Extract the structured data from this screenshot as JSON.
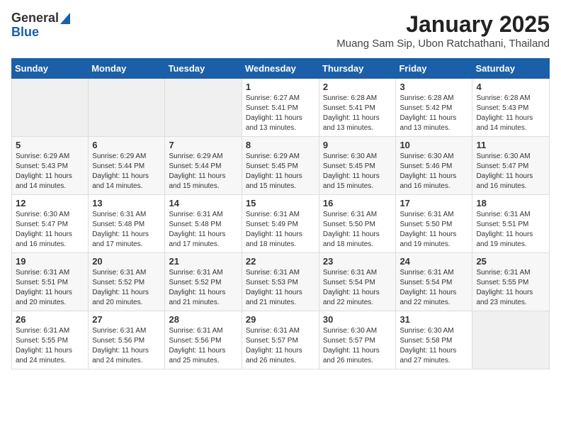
{
  "logo": {
    "general": "General",
    "blue": "Blue"
  },
  "header": {
    "month": "January 2025",
    "location": "Muang Sam Sip, Ubon Ratchathani, Thailand"
  },
  "weekdays": [
    "Sunday",
    "Monday",
    "Tuesday",
    "Wednesday",
    "Thursday",
    "Friday",
    "Saturday"
  ],
  "weeks": [
    [
      {
        "day": "",
        "sunrise": "",
        "sunset": "",
        "daylight": ""
      },
      {
        "day": "",
        "sunrise": "",
        "sunset": "",
        "daylight": ""
      },
      {
        "day": "",
        "sunrise": "",
        "sunset": "",
        "daylight": ""
      },
      {
        "day": "1",
        "sunrise": "Sunrise: 6:27 AM",
        "sunset": "Sunset: 5:41 PM",
        "daylight": "Daylight: 11 hours and 13 minutes."
      },
      {
        "day": "2",
        "sunrise": "Sunrise: 6:28 AM",
        "sunset": "Sunset: 5:41 PM",
        "daylight": "Daylight: 11 hours and 13 minutes."
      },
      {
        "day": "3",
        "sunrise": "Sunrise: 6:28 AM",
        "sunset": "Sunset: 5:42 PM",
        "daylight": "Daylight: 11 hours and 13 minutes."
      },
      {
        "day": "4",
        "sunrise": "Sunrise: 6:28 AM",
        "sunset": "Sunset: 5:43 PM",
        "daylight": "Daylight: 11 hours and 14 minutes."
      }
    ],
    [
      {
        "day": "5",
        "sunrise": "Sunrise: 6:29 AM",
        "sunset": "Sunset: 5:43 PM",
        "daylight": "Daylight: 11 hours and 14 minutes."
      },
      {
        "day": "6",
        "sunrise": "Sunrise: 6:29 AM",
        "sunset": "Sunset: 5:44 PM",
        "daylight": "Daylight: 11 hours and 14 minutes."
      },
      {
        "day": "7",
        "sunrise": "Sunrise: 6:29 AM",
        "sunset": "Sunset: 5:44 PM",
        "daylight": "Daylight: 11 hours and 15 minutes."
      },
      {
        "day": "8",
        "sunrise": "Sunrise: 6:29 AM",
        "sunset": "Sunset: 5:45 PM",
        "daylight": "Daylight: 11 hours and 15 minutes."
      },
      {
        "day": "9",
        "sunrise": "Sunrise: 6:30 AM",
        "sunset": "Sunset: 5:45 PM",
        "daylight": "Daylight: 11 hours and 15 minutes."
      },
      {
        "day": "10",
        "sunrise": "Sunrise: 6:30 AM",
        "sunset": "Sunset: 5:46 PM",
        "daylight": "Daylight: 11 hours and 16 minutes."
      },
      {
        "day": "11",
        "sunrise": "Sunrise: 6:30 AM",
        "sunset": "Sunset: 5:47 PM",
        "daylight": "Daylight: 11 hours and 16 minutes."
      }
    ],
    [
      {
        "day": "12",
        "sunrise": "Sunrise: 6:30 AM",
        "sunset": "Sunset: 5:47 PM",
        "daylight": "Daylight: 11 hours and 16 minutes."
      },
      {
        "day": "13",
        "sunrise": "Sunrise: 6:31 AM",
        "sunset": "Sunset: 5:48 PM",
        "daylight": "Daylight: 11 hours and 17 minutes."
      },
      {
        "day": "14",
        "sunrise": "Sunrise: 6:31 AM",
        "sunset": "Sunset: 5:48 PM",
        "daylight": "Daylight: 11 hours and 17 minutes."
      },
      {
        "day": "15",
        "sunrise": "Sunrise: 6:31 AM",
        "sunset": "Sunset: 5:49 PM",
        "daylight": "Daylight: 11 hours and 18 minutes."
      },
      {
        "day": "16",
        "sunrise": "Sunrise: 6:31 AM",
        "sunset": "Sunset: 5:50 PM",
        "daylight": "Daylight: 11 hours and 18 minutes."
      },
      {
        "day": "17",
        "sunrise": "Sunrise: 6:31 AM",
        "sunset": "Sunset: 5:50 PM",
        "daylight": "Daylight: 11 hours and 19 minutes."
      },
      {
        "day": "18",
        "sunrise": "Sunrise: 6:31 AM",
        "sunset": "Sunset: 5:51 PM",
        "daylight": "Daylight: 11 hours and 19 minutes."
      }
    ],
    [
      {
        "day": "19",
        "sunrise": "Sunrise: 6:31 AM",
        "sunset": "Sunset: 5:51 PM",
        "daylight": "Daylight: 11 hours and 20 minutes."
      },
      {
        "day": "20",
        "sunrise": "Sunrise: 6:31 AM",
        "sunset": "Sunset: 5:52 PM",
        "daylight": "Daylight: 11 hours and 20 minutes."
      },
      {
        "day": "21",
        "sunrise": "Sunrise: 6:31 AM",
        "sunset": "Sunset: 5:52 PM",
        "daylight": "Daylight: 11 hours and 21 minutes."
      },
      {
        "day": "22",
        "sunrise": "Sunrise: 6:31 AM",
        "sunset": "Sunset: 5:53 PM",
        "daylight": "Daylight: 11 hours and 21 minutes."
      },
      {
        "day": "23",
        "sunrise": "Sunrise: 6:31 AM",
        "sunset": "Sunset: 5:54 PM",
        "daylight": "Daylight: 11 hours and 22 minutes."
      },
      {
        "day": "24",
        "sunrise": "Sunrise: 6:31 AM",
        "sunset": "Sunset: 5:54 PM",
        "daylight": "Daylight: 11 hours and 22 minutes."
      },
      {
        "day": "25",
        "sunrise": "Sunrise: 6:31 AM",
        "sunset": "Sunset: 5:55 PM",
        "daylight": "Daylight: 11 hours and 23 minutes."
      }
    ],
    [
      {
        "day": "26",
        "sunrise": "Sunrise: 6:31 AM",
        "sunset": "Sunset: 5:55 PM",
        "daylight": "Daylight: 11 hours and 24 minutes."
      },
      {
        "day": "27",
        "sunrise": "Sunrise: 6:31 AM",
        "sunset": "Sunset: 5:56 PM",
        "daylight": "Daylight: 11 hours and 24 minutes."
      },
      {
        "day": "28",
        "sunrise": "Sunrise: 6:31 AM",
        "sunset": "Sunset: 5:56 PM",
        "daylight": "Daylight: 11 hours and 25 minutes."
      },
      {
        "day": "29",
        "sunrise": "Sunrise: 6:31 AM",
        "sunset": "Sunset: 5:57 PM",
        "daylight": "Daylight: 11 hours and 26 minutes."
      },
      {
        "day": "30",
        "sunrise": "Sunrise: 6:30 AM",
        "sunset": "Sunset: 5:57 PM",
        "daylight": "Daylight: 11 hours and 26 minutes."
      },
      {
        "day": "31",
        "sunrise": "Sunrise: 6:30 AM",
        "sunset": "Sunset: 5:58 PM",
        "daylight": "Daylight: 11 hours and 27 minutes."
      },
      {
        "day": "",
        "sunrise": "",
        "sunset": "",
        "daylight": ""
      }
    ]
  ]
}
